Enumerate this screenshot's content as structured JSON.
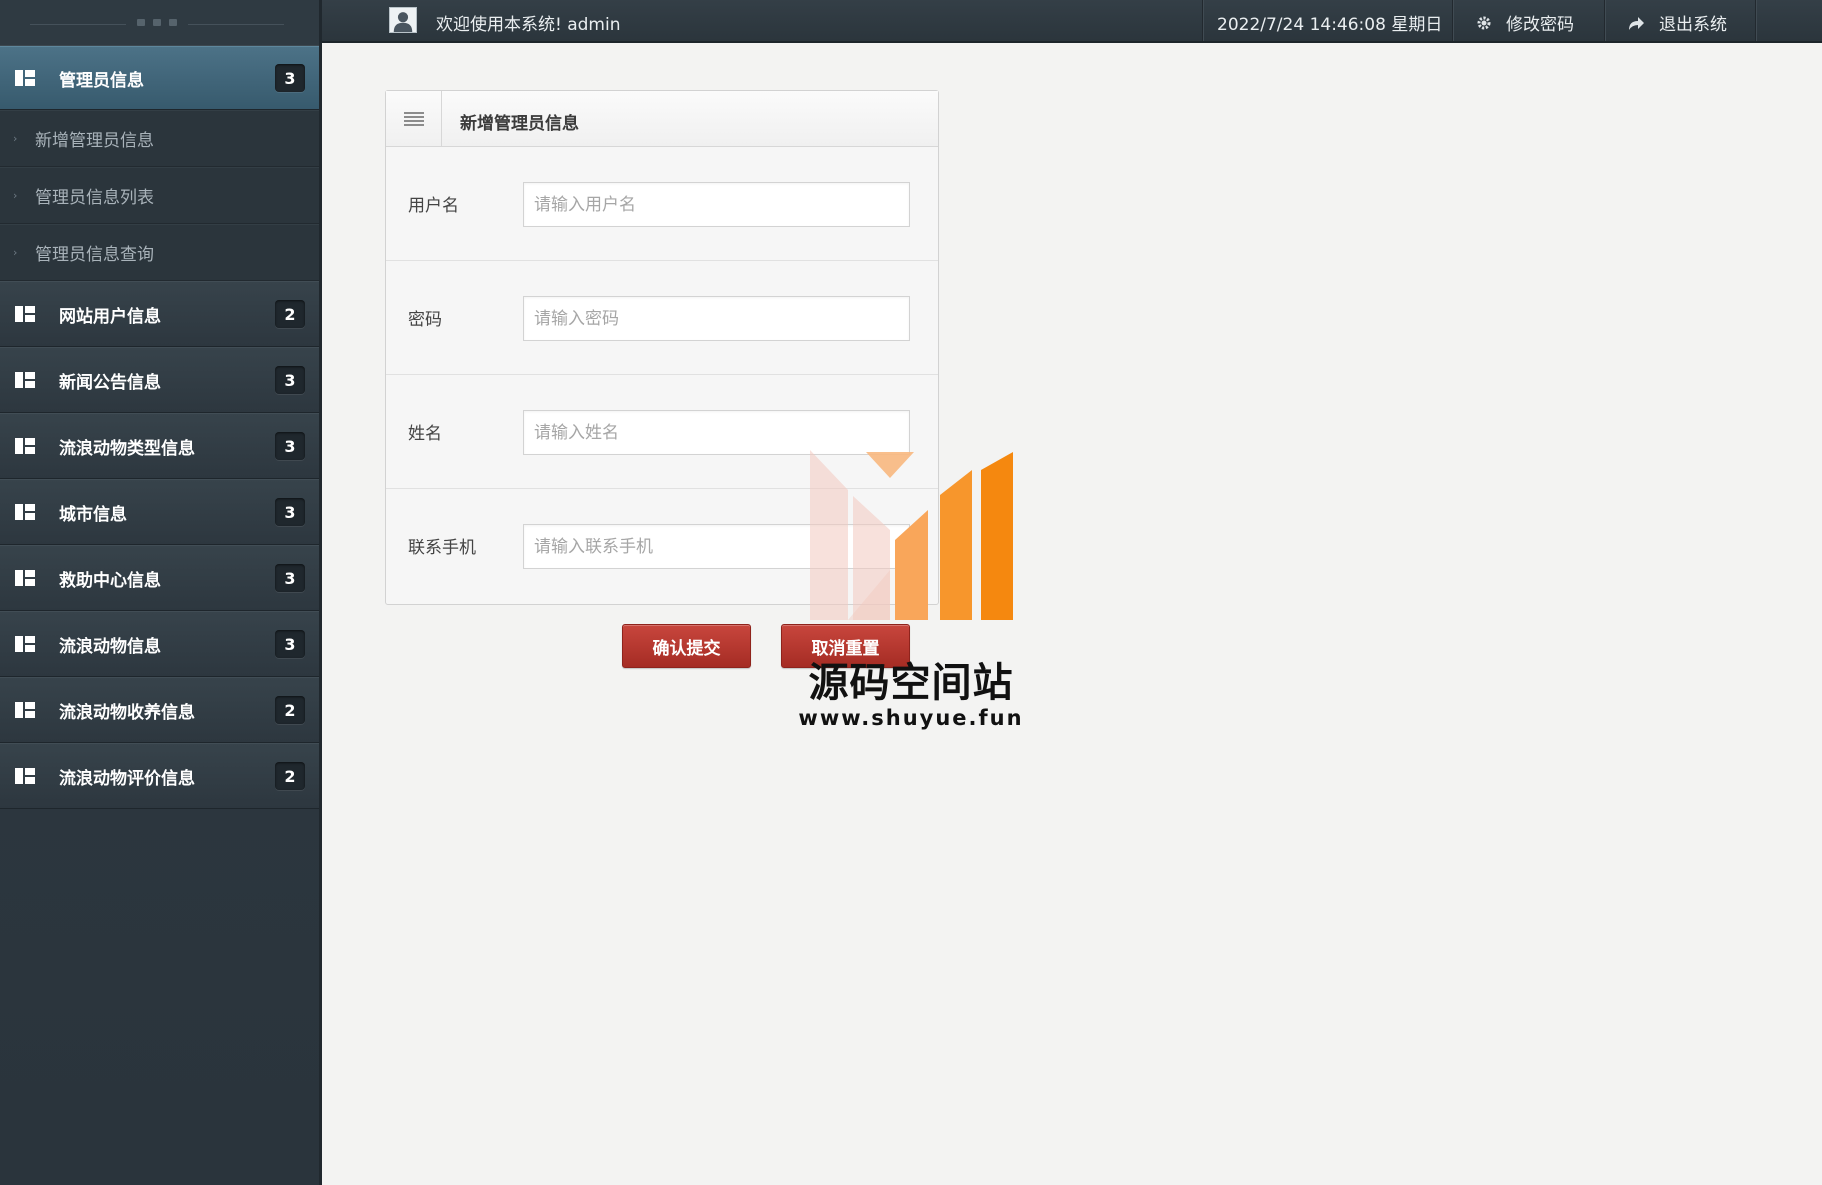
{
  "topbar": {
    "welcome": "欢迎使用本系统! admin",
    "datetime": "2022/7/24 14:46:08 星期日",
    "change_password": "修改密码",
    "logout": "退出系统"
  },
  "sidebar": {
    "active_group": {
      "label": "管理员信息",
      "count": "3",
      "sub_items": [
        "新增管理员信息",
        "管理员信息列表",
        "管理员信息查询"
      ]
    },
    "groups": [
      {
        "label": "网站用户信息",
        "count": "2"
      },
      {
        "label": "新闻公告信息",
        "count": "3"
      },
      {
        "label": "流浪动物类型信息",
        "count": "3"
      },
      {
        "label": "城市信息",
        "count": "3"
      },
      {
        "label": "救助中心信息",
        "count": "3"
      },
      {
        "label": "流浪动物信息",
        "count": "3"
      },
      {
        "label": "流浪动物收养信息",
        "count": "2"
      },
      {
        "label": "流浪动物评价信息",
        "count": "2"
      }
    ]
  },
  "form": {
    "title": "新增管理员信息",
    "fields": [
      {
        "label": "用户名",
        "placeholder": "请输入用户名",
        "value": ""
      },
      {
        "label": "密码",
        "placeholder": "请输入密码",
        "value": ""
      },
      {
        "label": "姓名",
        "placeholder": "请输入姓名",
        "value": ""
      },
      {
        "label": "联系手机",
        "placeholder": "请输入联系手机",
        "value": ""
      }
    ],
    "submit_label": "确认提交",
    "reset_label": "取消重置"
  },
  "watermark": {
    "name": "源码空间站",
    "url": "www.shuyue.fun"
  },
  "colors": {
    "sidebar_bg": "#2f3a42",
    "active_nav": "#4c7287",
    "button_red": "#b8372f",
    "watermark_orange": "#f5880f"
  }
}
